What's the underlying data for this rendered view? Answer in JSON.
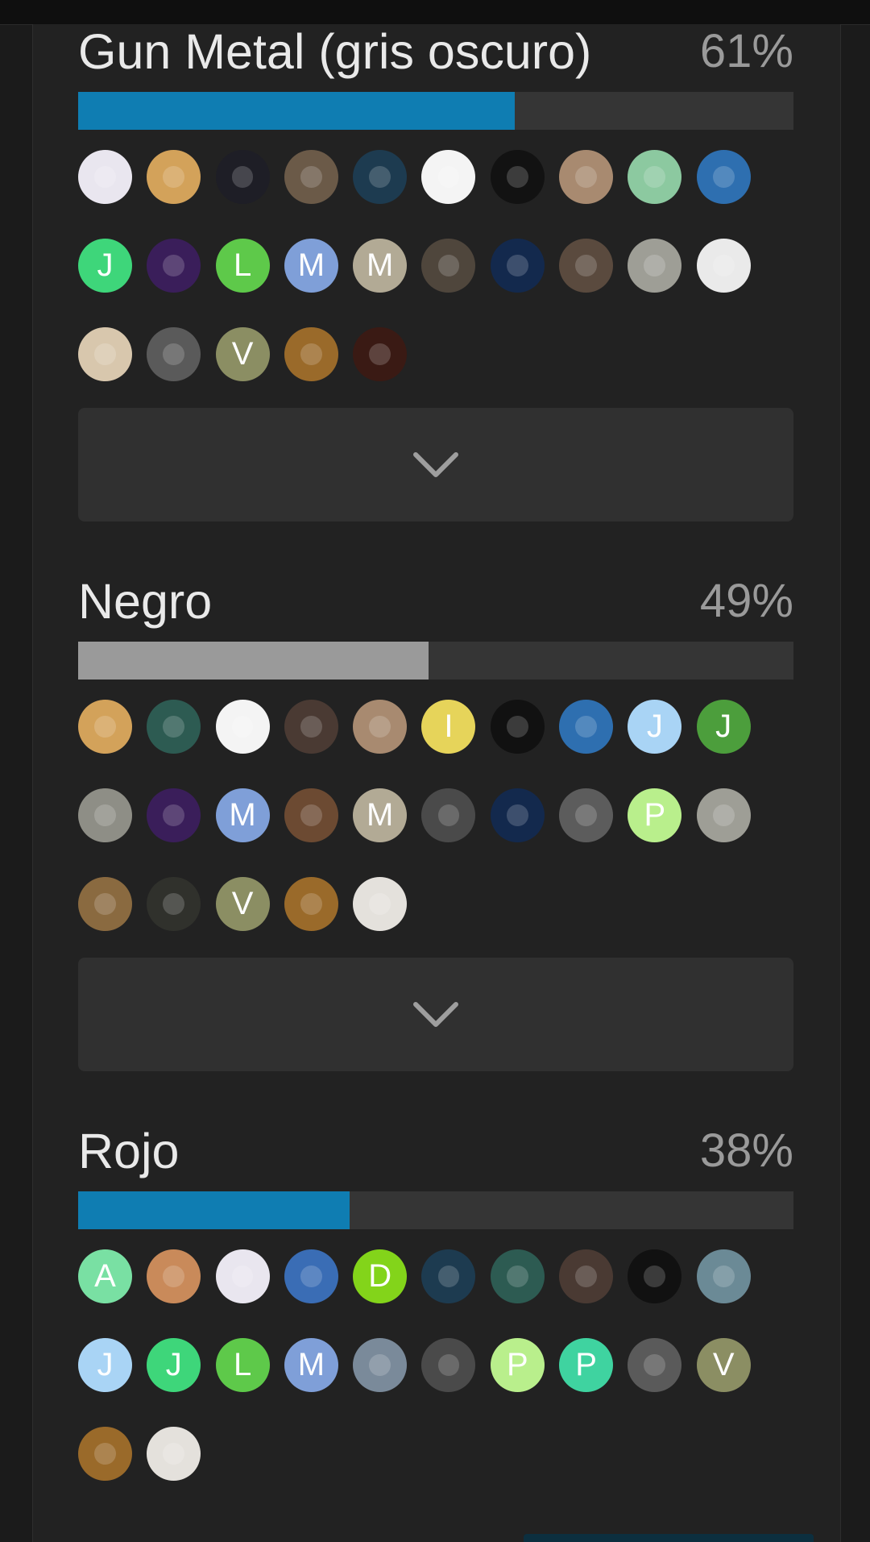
{
  "colors": {
    "blue_fill": "#0f7db2",
    "gray_fill": "#9a9a9a"
  },
  "options": [
    {
      "label": "Gun Metal (gris oscuro)",
      "percent_text": "61%",
      "fill_fraction": 0.61,
      "fill_color": "#0f7db2",
      "avatars": [
        {
          "letter": "",
          "icon": "document-avatar",
          "bg": "#e9e6ef"
        },
        {
          "letter": "",
          "icon": "box-avatar",
          "bg": "#d3a25a"
        },
        {
          "letter": "",
          "icon": "space-avatar",
          "bg": "#1e1e26"
        },
        {
          "letter": "",
          "icon": "person-avatar",
          "bg": "#6b5a48"
        },
        {
          "letter": "",
          "icon": "mandala-avatar",
          "bg": "#1d3b50"
        },
        {
          "letter": "",
          "icon": "knives-avatar",
          "bg": "#f4f4f4"
        },
        {
          "letter": "",
          "icon": "person-avatar",
          "bg": "#121212"
        },
        {
          "letter": "",
          "icon": "fox-avatar",
          "bg": "#a88a70"
        },
        {
          "letter": "",
          "icon": "dinosaur-avatar",
          "bg": "#8cc9a0"
        },
        {
          "letter": "",
          "icon": "cartoon-avatar",
          "bg": "#2e6fb0"
        },
        {
          "letter": "J",
          "icon": "",
          "bg": "#3ed67a"
        },
        {
          "letter": "",
          "icon": "cartoon-avatar",
          "bg": "#3a1e5a"
        },
        {
          "letter": "L",
          "icon": "",
          "bg": "#5ec94a"
        },
        {
          "letter": "M",
          "icon": "",
          "bg": "#7f9fd8"
        },
        {
          "letter": "M",
          "icon": "",
          "bg": "#b2aa95"
        },
        {
          "letter": "",
          "icon": "person-avatar",
          "bg": "#4f463c"
        },
        {
          "letter": "",
          "icon": "person-avatar",
          "bg": "#13294d"
        },
        {
          "letter": "",
          "icon": "person-avatar",
          "bg": "#5a4a3e"
        },
        {
          "letter": "",
          "icon": "statue-avatar",
          "bg": "#9e9e96"
        },
        {
          "letter": "",
          "icon": "statue-avatar",
          "bg": "#eaeaea"
        },
        {
          "letter": "",
          "icon": "cookie-monster-avatar",
          "bg": "#d8c7ad"
        },
        {
          "letter": "",
          "icon": "apple-avatar",
          "bg": "#5a5a5a"
        },
        {
          "letter": "V",
          "icon": "",
          "bg": "#8b8e63"
        },
        {
          "letter": "",
          "icon": "emblem-avatar",
          "bg": "#9a6a2a"
        },
        {
          "letter": "",
          "icon": "silhouette-avatar",
          "bg": "#3a1a14"
        }
      ]
    },
    {
      "label": "Negro",
      "percent_text": "49%",
      "fill_fraction": 0.49,
      "fill_color": "#9a9a9a",
      "avatars": [
        {
          "letter": "",
          "icon": "box-avatar",
          "bg": "#d3a25a"
        },
        {
          "letter": "",
          "icon": "turtle-avatar",
          "bg": "#2d5b52"
        },
        {
          "letter": "",
          "icon": "knives-avatar",
          "bg": "#f4f4f4"
        },
        {
          "letter": "",
          "icon": "person-avatar",
          "bg": "#4a3a33"
        },
        {
          "letter": "",
          "icon": "fox-avatar",
          "bg": "#a88a70"
        },
        {
          "letter": "I",
          "icon": "",
          "bg": "#e6d45a"
        },
        {
          "letter": "",
          "icon": "badger-avatar",
          "bg": "#111111"
        },
        {
          "letter": "",
          "icon": "cartoon-avatar",
          "bg": "#2e6fb0"
        },
        {
          "letter": "J",
          "icon": "",
          "bg": "#a9d4f5"
        },
        {
          "letter": "J",
          "icon": "",
          "bg": "#4c9e3c"
        },
        {
          "letter": "",
          "icon": "detective-avatar",
          "bg": "#8e8e86"
        },
        {
          "letter": "",
          "icon": "cartoon-avatar",
          "bg": "#3a1e5a"
        },
        {
          "letter": "M",
          "icon": "",
          "bg": "#7f9fd8"
        },
        {
          "letter": "",
          "icon": "monkey-avatar",
          "bg": "#6c4a32"
        },
        {
          "letter": "M",
          "icon": "",
          "bg": "#b2aa95"
        },
        {
          "letter": "",
          "icon": "person-avatar",
          "bg": "#4a4a4a"
        },
        {
          "letter": "",
          "icon": "person-avatar",
          "bg": "#13294d"
        },
        {
          "letter": "",
          "icon": "person-avatar",
          "bg": "#5c5c5c"
        },
        {
          "letter": "P",
          "icon": "",
          "bg": "#b9ef8c"
        },
        {
          "letter": "",
          "icon": "statue-avatar",
          "bg": "#9e9e96"
        },
        {
          "letter": "",
          "icon": "revolver-avatar",
          "bg": "#8a6a40"
        },
        {
          "letter": "",
          "icon": "person-avatar",
          "bg": "#30312c"
        },
        {
          "letter": "V",
          "icon": "",
          "bg": "#8b8e63"
        },
        {
          "letter": "",
          "icon": "emblem-avatar",
          "bg": "#9a6a2a"
        },
        {
          "letter": "",
          "icon": "newspaper-avatar",
          "bg": "#e4e1dc"
        }
      ]
    },
    {
      "label": "Rojo",
      "percent_text": "38%",
      "fill_fraction": 0.38,
      "fill_color": "#0f7db2",
      "avatars": [
        {
          "letter": "A",
          "icon": "",
          "bg": "#79e0a3"
        },
        {
          "letter": "",
          "icon": "pirate-avatar",
          "bg": "#c98a5a"
        },
        {
          "letter": "",
          "icon": "document-avatar",
          "bg": "#e9e6ef"
        },
        {
          "letter": "",
          "icon": "collage-avatar",
          "bg": "#3a6db5"
        },
        {
          "letter": "D",
          "icon": "",
          "bg": "#83d41a"
        },
        {
          "letter": "",
          "icon": "mandala-avatar",
          "bg": "#1d3b50"
        },
        {
          "letter": "",
          "icon": "turtle-avatar",
          "bg": "#2d5b52"
        },
        {
          "letter": "",
          "icon": "person-avatar",
          "bg": "#4a3a33"
        },
        {
          "letter": "",
          "icon": "badger-avatar",
          "bg": "#111111"
        },
        {
          "letter": "",
          "icon": "landscape-avatar",
          "bg": "#6b8a96"
        },
        {
          "letter": "J",
          "icon": "",
          "bg": "#a9d4f5"
        },
        {
          "letter": "J",
          "icon": "",
          "bg": "#3ed67a"
        },
        {
          "letter": "L",
          "icon": "",
          "bg": "#5ec94a"
        },
        {
          "letter": "M",
          "icon": "",
          "bg": "#7f9fd8"
        },
        {
          "letter": "",
          "icon": "cowboy-avatar",
          "bg": "#7a8a9a"
        },
        {
          "letter": "",
          "icon": "person-avatar",
          "bg": "#4a4a4a"
        },
        {
          "letter": "P",
          "icon": "",
          "bg": "#b9ef8c"
        },
        {
          "letter": "P",
          "icon": "",
          "bg": "#3fd3a0"
        },
        {
          "letter": "",
          "icon": "apple-avatar",
          "bg": "#5a5a5a"
        },
        {
          "letter": "V",
          "icon": "",
          "bg": "#8b8e63"
        },
        {
          "letter": "",
          "icon": "emblem-avatar",
          "bg": "#9a6a2a"
        },
        {
          "letter": "",
          "icon": "newspaper-avatar",
          "bg": "#e4e1dc"
        }
      ]
    }
  ],
  "expand_icon": "chevron-down-icon"
}
